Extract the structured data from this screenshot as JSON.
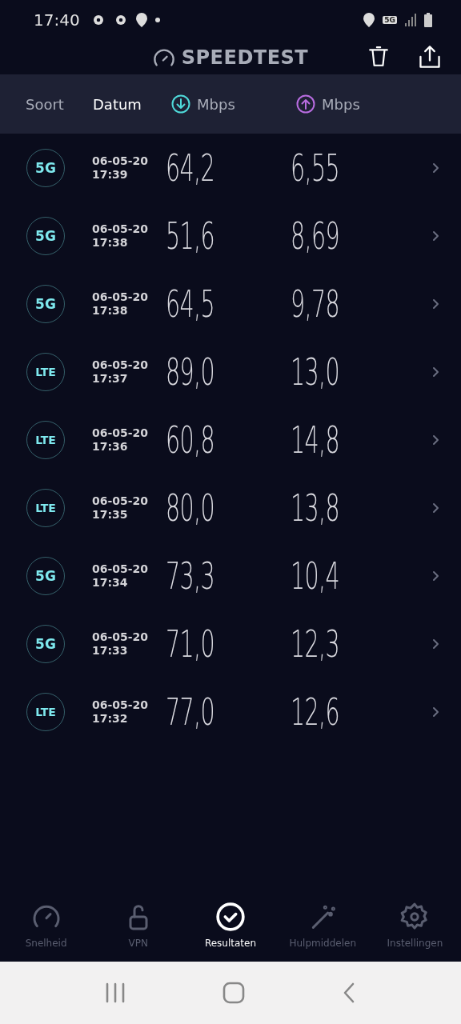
{
  "status_bar": {
    "time": "17:40",
    "network": "5G"
  },
  "header": {
    "title": "SPEEDTEST"
  },
  "sort_bar": {
    "label": "Soort",
    "options": [
      {
        "kind": "date",
        "label": "Datum",
        "selected": true
      },
      {
        "kind": "download",
        "label": "Mbps",
        "selected": false
      },
      {
        "kind": "upload",
        "label": "Mbps",
        "selected": false
      }
    ]
  },
  "results": [
    {
      "network": "5G",
      "date": "06-05-20",
      "time": "17:39",
      "download": "64,2",
      "upload": "6,55"
    },
    {
      "network": "5G",
      "date": "06-05-20",
      "time": "17:38",
      "download": "51,6",
      "upload": "8,69"
    },
    {
      "network": "5G",
      "date": "06-05-20",
      "time": "17:38",
      "download": "64,5",
      "upload": "9,78"
    },
    {
      "network": "LTE",
      "date": "06-05-20",
      "time": "17:37",
      "download": "89,0",
      "upload": "13,0"
    },
    {
      "network": "LTE",
      "date": "06-05-20",
      "time": "17:36",
      "download": "60,8",
      "upload": "14,8"
    },
    {
      "network": "LTE",
      "date": "06-05-20",
      "time": "17:35",
      "download": "80,0",
      "upload": "13,8"
    },
    {
      "network": "5G",
      "date": "06-05-20",
      "time": "17:34",
      "download": "73,3",
      "upload": "10,4"
    },
    {
      "network": "5G",
      "date": "06-05-20",
      "time": "17:33",
      "download": "71,0",
      "upload": "12,3"
    },
    {
      "network": "LTE",
      "date": "06-05-20",
      "time": "17:32",
      "download": "77,0",
      "upload": "12,6"
    }
  ],
  "bottom_nav": [
    {
      "kind": "speed",
      "label": "Snelheid",
      "selected": false
    },
    {
      "kind": "vpn",
      "label": "VPN",
      "selected": false
    },
    {
      "kind": "results",
      "label": "Resultaten",
      "selected": true
    },
    {
      "kind": "tools",
      "label": "Hulpmiddelen",
      "selected": false
    },
    {
      "kind": "settings",
      "label": "Instellingen",
      "selected": false
    }
  ]
}
